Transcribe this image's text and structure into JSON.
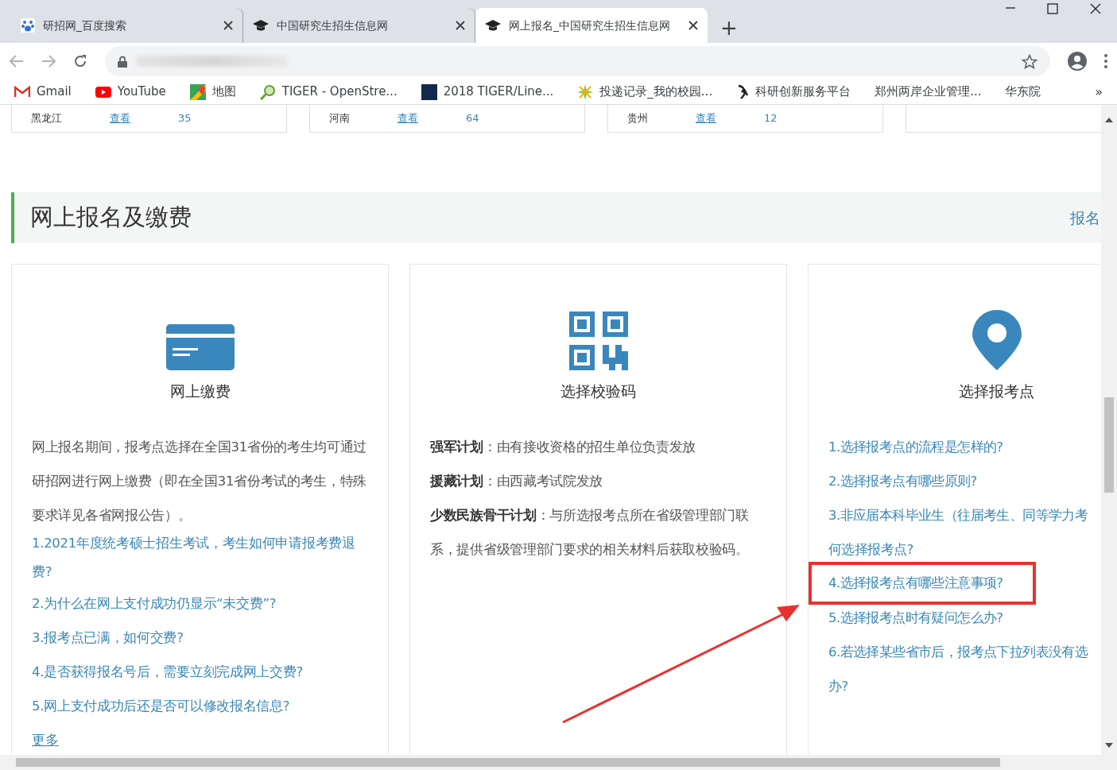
{
  "browser": {
    "tabs": [
      {
        "title": "研招网_百度搜索",
        "selected": false
      },
      {
        "title": "中国研究生招生信息网",
        "selected": false
      },
      {
        "title": "网上报名_中国研究生招生信息网",
        "selected": true
      }
    ],
    "new_tab": "+",
    "bookmarks": [
      {
        "label": "Gmail"
      },
      {
        "label": "YouTube"
      },
      {
        "label": "地图"
      },
      {
        "label": "TIGER - OpenStre..."
      },
      {
        "label": "2018 TIGER/Line..."
      },
      {
        "label": "投递记录_我的校园..."
      },
      {
        "label": "科研创新服务平台"
      },
      {
        "label": "郑州两岸企业管理..."
      },
      {
        "label": "华东院"
      }
    ],
    "more_bookmarks": "»"
  },
  "province_cards": [
    {
      "province": "黑龙江",
      "link": "查看",
      "count": "35"
    },
    {
      "province": "河南",
      "link": "查看",
      "count": "64"
    },
    {
      "province": "贵州",
      "link": "查看",
      "count": "12"
    }
  ],
  "partial_card": true,
  "section": {
    "title": "网上报名及缴费",
    "more_link": "报名",
    "cards": [
      {
        "label": "网上缴费",
        "paragraphs": [
          "网上报名期间，报考点选择在全国31省份的考生均可通过研招网进行网上缴费（即在全国31省份考试的考生，特殊要求详见各省网报公告）。"
        ],
        "links": [
          {
            "lines": [
              "1.2021年度统考硕士招生考试，考生如何申请报考费退费?"
            ],
            "highlighted": false
          },
          {
            "lines": [
              "2.为什么在网上支付成功仍显示“未交费”?"
            ],
            "highlighted": false
          },
          {
            "lines": [
              "3.报考点已满，如何交费?"
            ],
            "highlighted": false
          },
          {
            "lines": [
              "4.是否获得报名号后，需要立刻完成网上交费?"
            ],
            "highlighted": false
          },
          {
            "lines": [
              "5.网上支付成功后还是否可以修改报名信息?"
            ],
            "highlighted": false
          }
        ],
        "more": "更多"
      },
      {
        "label": "选择校验码",
        "paragraphs": [
          "**强军计划**：由有接收资格的招生单位负责发放",
          "**援藏计划**：由西藏考试院发放",
          "**少数民族骨干计划**：与所选报考点所在省级管理部门联系，提供省级管理部门要求的相关材料后获取校验码。"
        ]
      },
      {
        "label": "选择报考点",
        "links": [
          {
            "lines": [
              "1.选择报考点的流程是怎样的?"
            ],
            "highlighted": false
          },
          {
            "lines": [
              "2.选择报考点有哪些原则?"
            ],
            "highlighted": false
          },
          {
            "lines": [
              "3.非应届本科毕业生（往届考生、同等学力考",
              "何选择报考点?"
            ],
            "highlighted": false
          },
          {
            "lines": [
              "4.选择报考点有哪些注意事项?"
            ],
            "highlighted": true
          },
          {
            "lines": [
              "5.选择报考点时有疑问怎么办?"
            ],
            "highlighted": false
          },
          {
            "lines": [
              "6.若选择某些省市后，报考点下拉列表没有选",
              "办?"
            ],
            "highlighted": false
          }
        ]
      }
    ]
  },
  "annotation_arrow": true
}
